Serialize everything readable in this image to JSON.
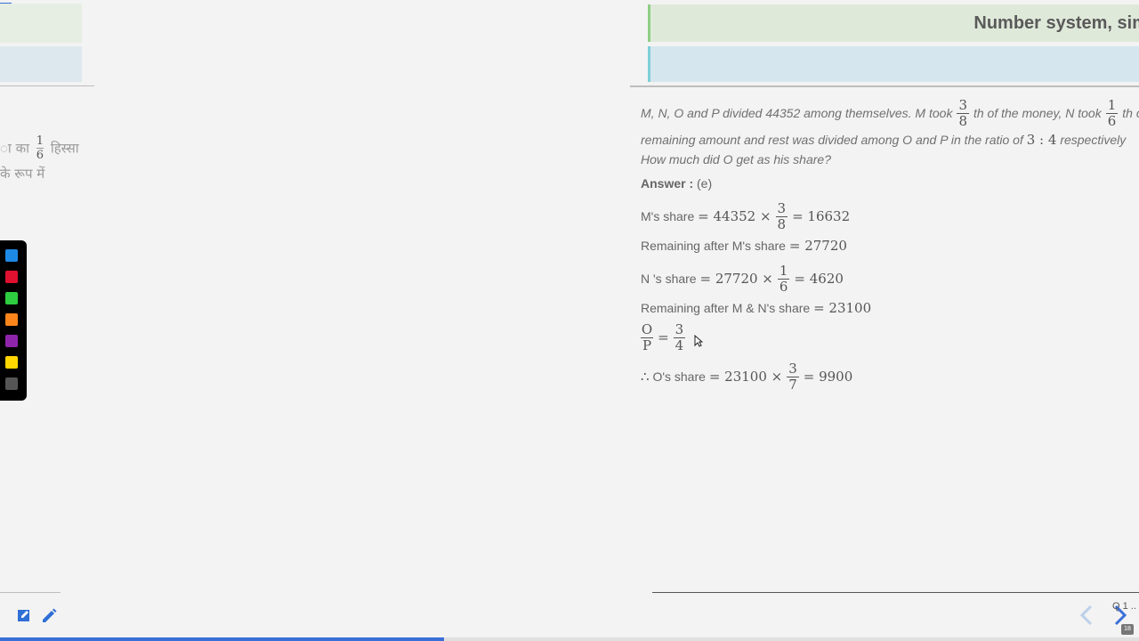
{
  "header": {
    "title": "Number system, simplif"
  },
  "left_panel": {
    "hindi_line1_prefix": "ा का",
    "hindi_frac_num": "1",
    "hindi_frac_den": "6",
    "hindi_line1_suffix": "हिस्सा",
    "hindi_line2": "के रूप में"
  },
  "palette": {
    "colors": [
      "#1e88e5",
      "#e0102f",
      "#2ecc40",
      "#ff851b",
      "#8e24aa",
      "#ffd600",
      "#555555"
    ]
  },
  "question": {
    "part1": "M, N, O and P divided 44352 among themselves. M took",
    "frac1_num": "3",
    "frac1_den": "8",
    "part2": "th of the money, N took",
    "frac2_num": "1",
    "frac2_den": "6",
    "part3": "th o",
    "line2": "remaining amount and rest was divided among O and P in the ratio of",
    "ratio": "3 : 4",
    "line2_end": "respectively",
    "line3": "How much did O get as his share?"
  },
  "answer": {
    "label": "Answer :",
    "value": "(e)"
  },
  "solution": {
    "m_share_label": "M's share",
    "m_share_base": "= 44352 ×",
    "m_frac_num": "3",
    "m_frac_den": "8",
    "m_share_result": "= 16632",
    "rem1_label": "Remaining after M's share",
    "rem1_value": "= 27720",
    "n_share_label": "N 's share",
    "n_share_base": "= 27720 ×",
    "n_frac_num": "1",
    "n_frac_den": "6",
    "n_share_result": "= 4620",
    "rem2_label": "Remaining after M & N's share",
    "rem2_value": "= 23100",
    "op_num": "O",
    "op_den": "P",
    "op_eq": "=",
    "op_frac_num": "3",
    "op_frac_den": "4",
    "o_share_prefix": "∴",
    "o_share_label": "O's share",
    "o_share_base": "= 23100 ×",
    "o_frac_num": "3",
    "o_frac_den": "7",
    "o_share_result": "= 9900"
  },
  "footer": {
    "page_indicator": "Q 1 ..",
    "badge": "18",
    "progress_percent": 39
  }
}
